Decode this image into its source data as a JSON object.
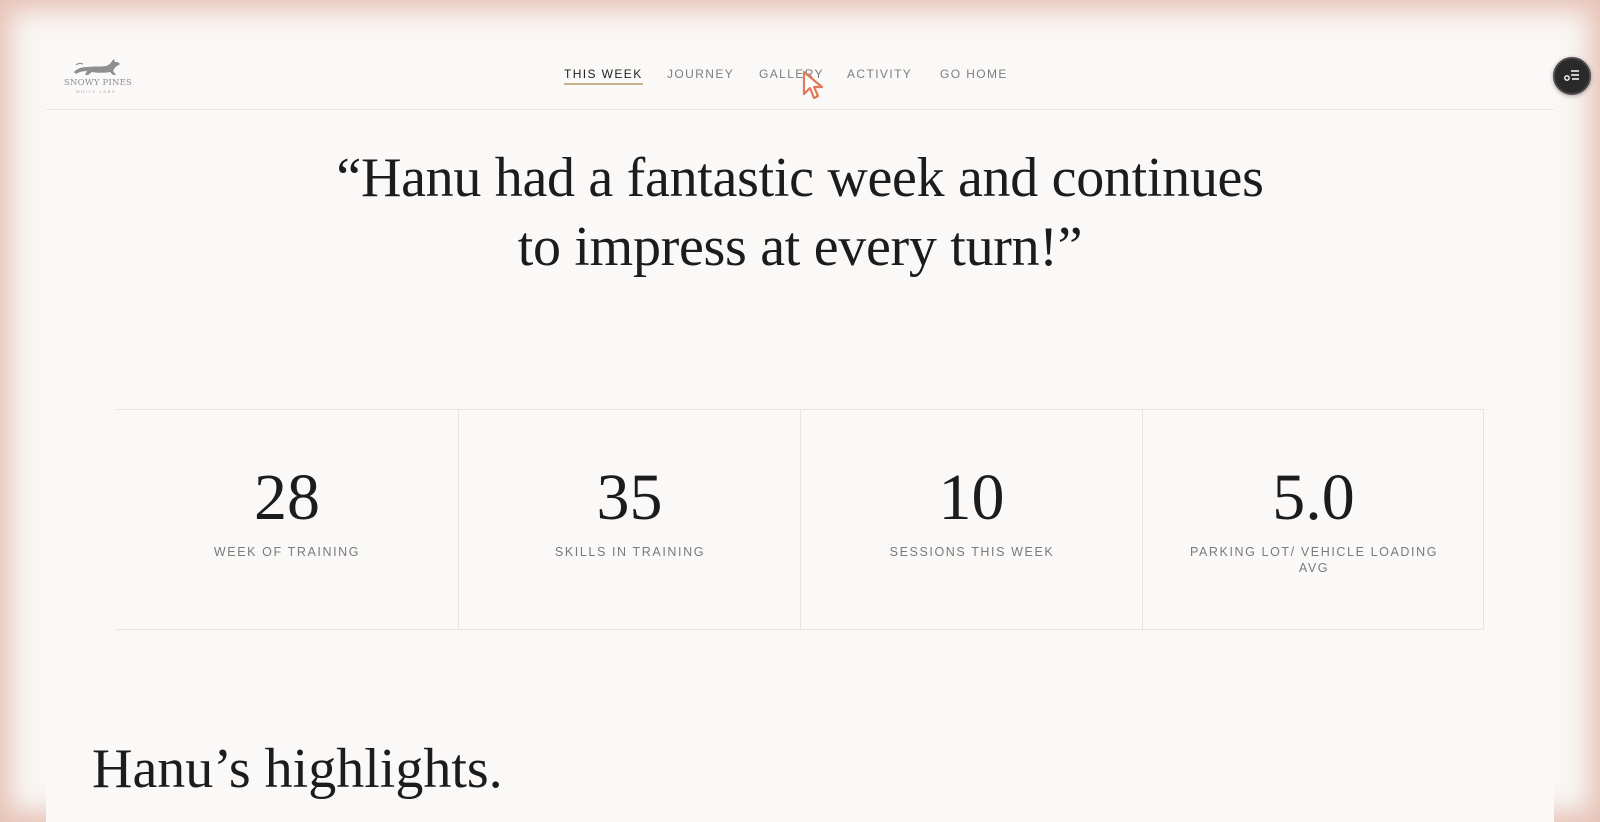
{
  "brand": {
    "name": "SNOWY PINES",
    "tagline": "WHITE LABS"
  },
  "nav": {
    "items": [
      {
        "label": "THIS WEEK",
        "active": true
      },
      {
        "label": "JOURNEY",
        "active": false
      },
      {
        "label": "GALLERY",
        "active": false
      },
      {
        "label": "ACTIVITY",
        "active": false
      },
      {
        "label": "GO HOME",
        "active": false
      }
    ],
    "accent_color": "#c9b38d"
  },
  "menu_button": {
    "icon": "list-settings-icon"
  },
  "quote": {
    "line1": "“Hanu had a fantastic week and continues",
    "line2": "to impress at every turn!”"
  },
  "stats": [
    {
      "value": "28",
      "label": "WEEK OF TRAINING"
    },
    {
      "value": "35",
      "label": "SKILLS IN TRAINING"
    },
    {
      "value": "10",
      "label": "SESSIONS THIS WEEK"
    },
    {
      "value": "5.0",
      "label": "PARKING LOT/ VEHICLE LOADING AVG"
    }
  ],
  "highlights": {
    "title": "Hanu’s highlights."
  },
  "colors": {
    "text_dark": "#1c1c1c",
    "text_muted": "#7a7a7a",
    "background": "#fbf9f8",
    "frame_glow": "#d69680"
  }
}
